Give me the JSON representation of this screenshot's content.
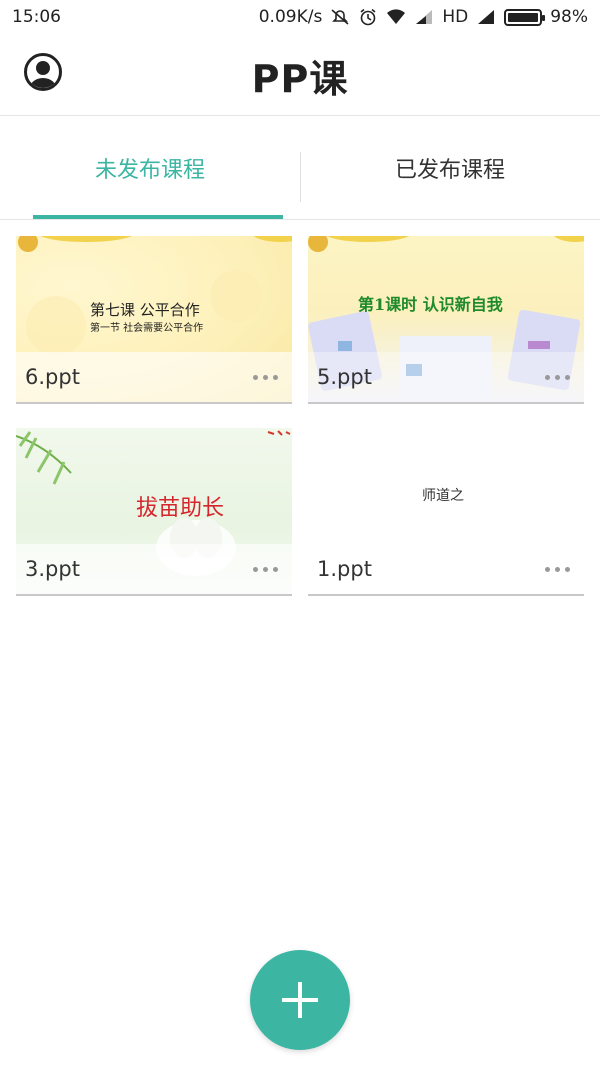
{
  "status_bar": {
    "time": "15:06",
    "network_speed": "0.09K/s",
    "network_type": "HD",
    "battery": "98%",
    "battery_level": 0.98,
    "icons": [
      "mute-icon",
      "alarm-icon",
      "wifi-icon",
      "signal-icon",
      "signal-icon",
      "battery-icon"
    ]
  },
  "header": {
    "title": "PP课",
    "avatar_icon": "user-avatar-icon"
  },
  "tabs": [
    {
      "label": "未发布课程",
      "active": true
    },
    {
      "label": "已发布课程",
      "active": false
    }
  ],
  "cards": [
    {
      "file": "6.ppt",
      "slide_title": "第七课      公平合作",
      "slide_subtitle": "第一节     社会需要公平合作"
    },
    {
      "file": "5.ppt",
      "slide_title": "第1课时    认识新自我"
    },
    {
      "file": "3.ppt",
      "slide_title": "拔苗助长"
    },
    {
      "file": "1.ppt",
      "slide_title": "师道之"
    }
  ],
  "fab": {
    "icon": "plus-icon"
  },
  "colors": {
    "accent": "#3cb5a3",
    "text": "#333333",
    "divider": "#e6e6e6"
  }
}
